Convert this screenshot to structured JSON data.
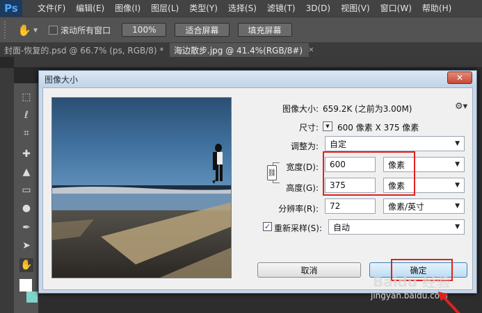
{
  "app": {
    "logo": "Ps"
  },
  "menu": [
    "文件(F)",
    "编辑(E)",
    "图像(I)",
    "图层(L)",
    "类型(Y)",
    "选择(S)",
    "滤镜(T)",
    "3D(D)",
    "视图(V)",
    "窗口(W)",
    "帮助(H)"
  ],
  "options_bar": {
    "tool_icon": "hand-icon",
    "scroll_all_label": "滚动所有窗口",
    "zoom_100": "100%",
    "fit_screen": "适合屏幕",
    "fill_screen": "填充屏幕"
  },
  "tabs": [
    {
      "label": "封面-恢复的.psd @ 66.7% (ps, RGB/8) *",
      "active": false
    },
    {
      "label": "海边散步.jpg @ 41.4%(RGB/8#)",
      "active": true
    }
  ],
  "dialog": {
    "title": "图像大小",
    "close_label": "✕",
    "image_size_label": "图像大小:",
    "image_size_value": "659.2K (之前为3.00M)",
    "dimensions_label": "尺寸:",
    "dimensions_value": "600 像素  X  375 像素",
    "fit_to_label": "调整为:",
    "fit_to_value": "自定",
    "width_label": "宽度(D):",
    "width_value": "600",
    "width_unit": "像素",
    "height_label": "高度(G):",
    "height_value": "375",
    "height_unit": "像素",
    "resolution_label": "分辨率(R):",
    "resolution_value": "72",
    "resolution_unit": "像素/英寸",
    "resample_label": "重新采样(S):",
    "resample_checked": true,
    "resample_value": "自动",
    "cancel_label": "取消",
    "ok_label": "确定"
  },
  "watermark": {
    "brand": "Baidu 经验",
    "url": "jingyan.baidu.com"
  },
  "colors": {
    "highlight": "#e02020",
    "dialog_bg": "#f0f0f0",
    "ps_blue": "#4aa8ff"
  }
}
